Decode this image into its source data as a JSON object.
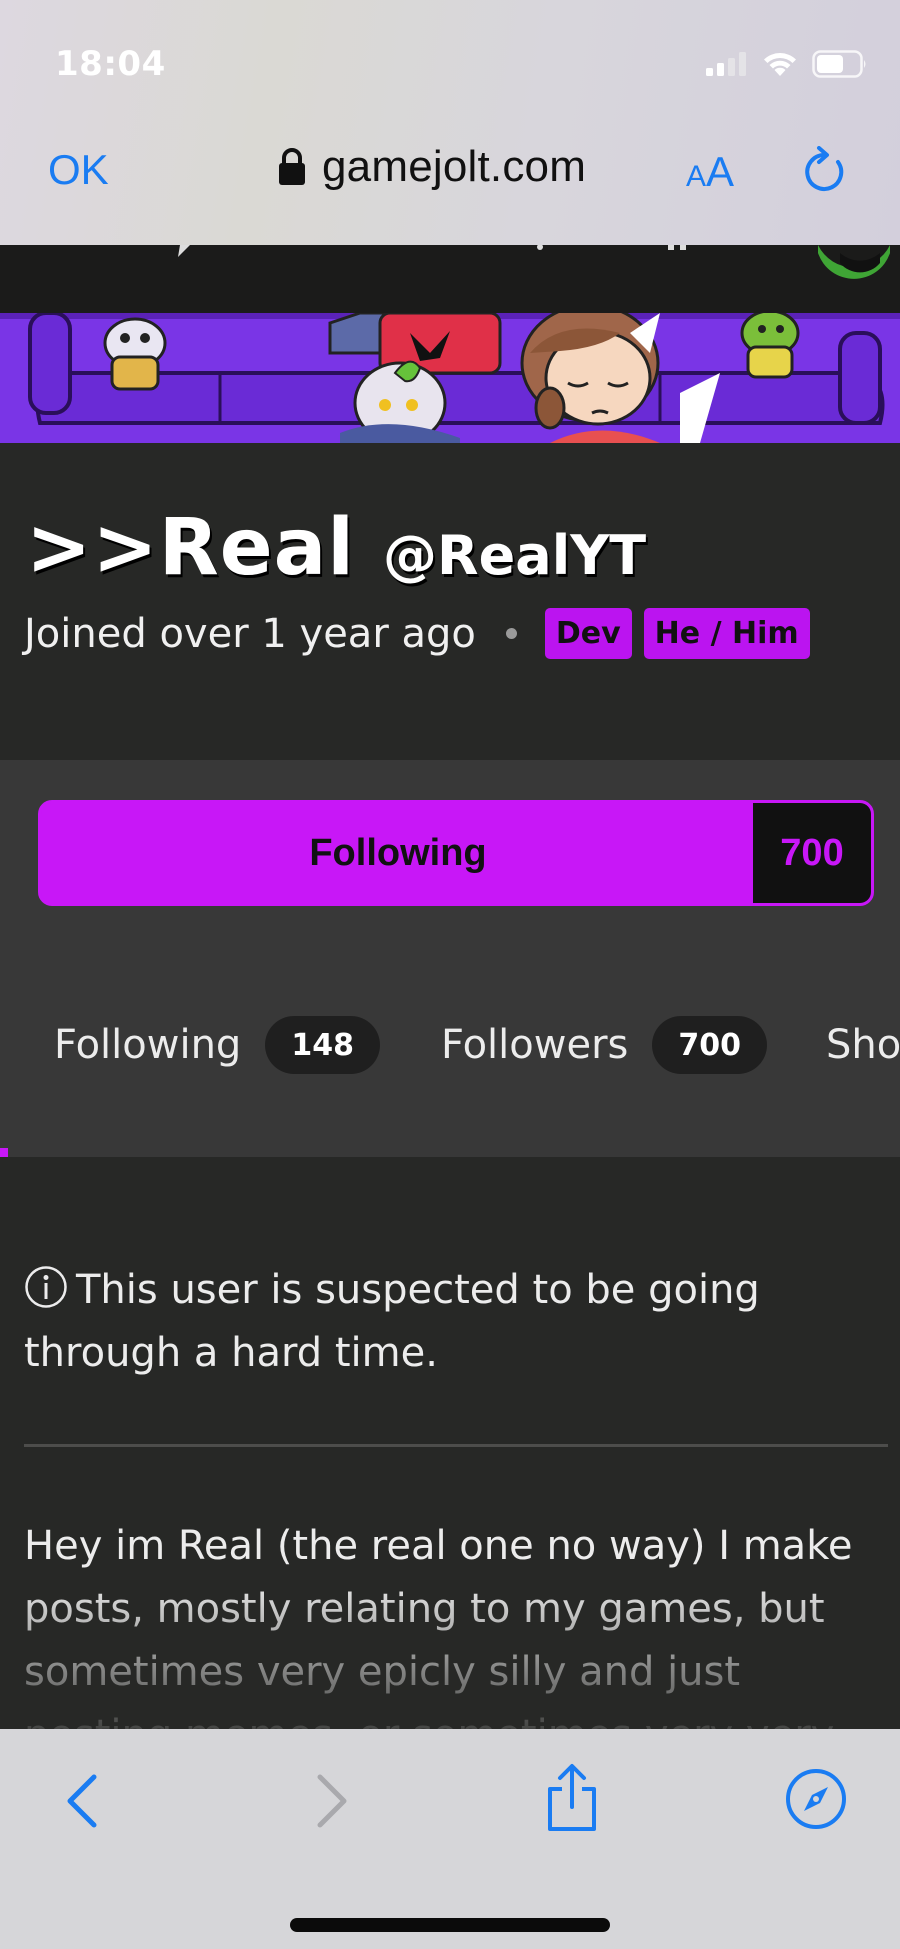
{
  "status_bar": {
    "time": "18:04"
  },
  "browser": {
    "done_label": "OK",
    "url": "gamejolt.com",
    "text_size_small": "A",
    "text_size_big": "A"
  },
  "profile": {
    "display_name": ">>Real",
    "username": "@RealYT",
    "joined": "Joined over 1 year ago",
    "tags": [
      "Dev",
      "He / Him"
    ]
  },
  "follow_button": {
    "label": "Following",
    "count": "700"
  },
  "tabs": [
    {
      "label": "Following",
      "count": "148"
    },
    {
      "label": "Followers",
      "count": "700"
    },
    {
      "label": "Sho",
      "count": ""
    }
  ],
  "notice": "This user is suspected to be going through a hard time.",
  "bio": "Hey im Real (the real one no way) I make posts, mostly relating to my games, but sometimes very epicly silly and just posting memes, or sometimes very very",
  "colors": {
    "accent": "#c817f7",
    "ios_blue": "#1a7cf2",
    "background": "#272826"
  },
  "toolbar_icons": [
    "back-icon",
    "forward-icon",
    "share-icon",
    "compass-icon"
  ]
}
